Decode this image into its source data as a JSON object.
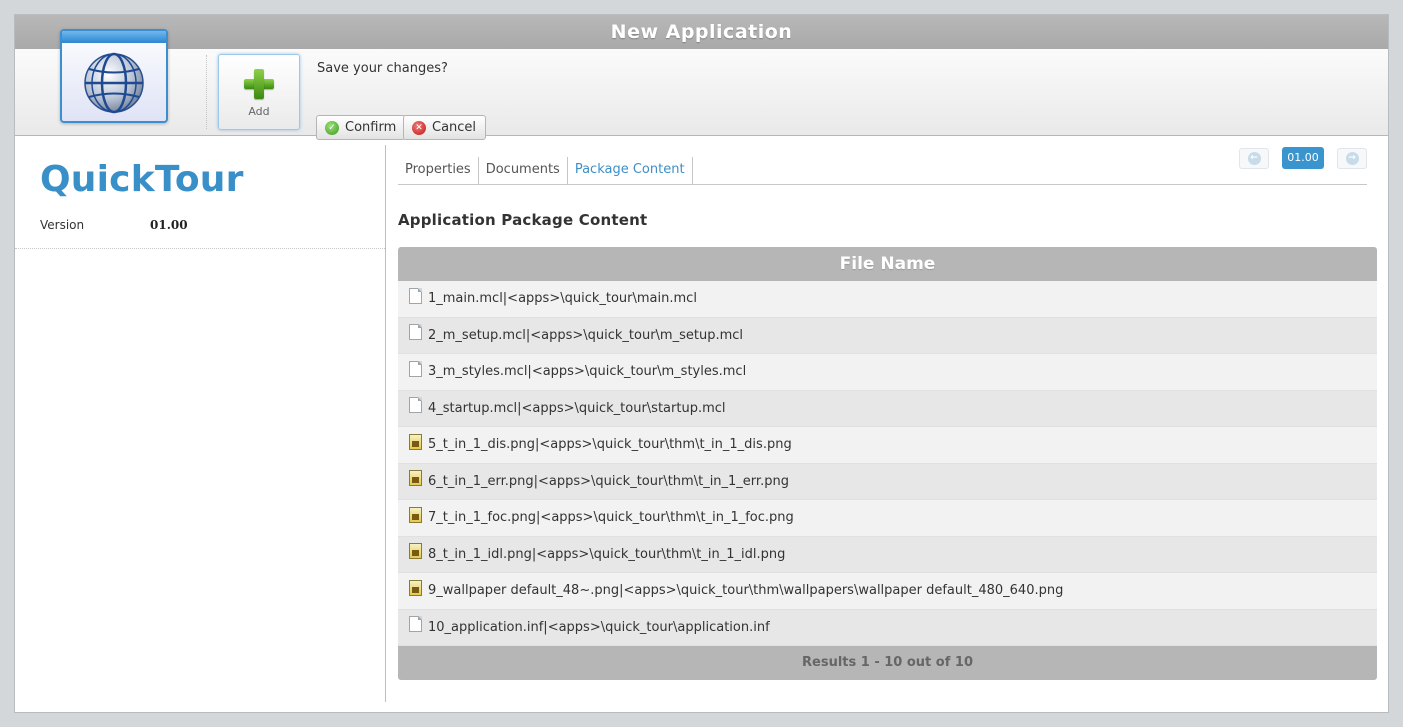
{
  "window": {
    "title": "New Application"
  },
  "toolbar": {
    "app_icon": "globe-window-icon",
    "add_label": "Add",
    "prompt": "Save your changes?",
    "confirm_label": "Confirm",
    "cancel_label": "Cancel",
    "confirm_icon": "check-circle-icon",
    "cancel_icon": "x-circle-icon"
  },
  "app": {
    "name": "QuickTour",
    "version_label": "Version",
    "version_value": "01.00"
  },
  "tabs": [
    {
      "label": "Properties",
      "active": false
    },
    {
      "label": "Documents",
      "active": false
    },
    {
      "label": "Package Content",
      "active": true
    }
  ],
  "pager": {
    "version": "01.00",
    "prev_icon": "arrow-left-circle-icon",
    "next_icon": "arrow-right-circle-icon"
  },
  "section_title": "Application Package Content",
  "grid": {
    "header": "File Name",
    "rows": [
      {
        "name": "1_main.mcl|<apps>\\quick_tour\\main.mcl",
        "icon": "doc"
      },
      {
        "name": "2_m_setup.mcl|<apps>\\quick_tour\\m_setup.mcl",
        "icon": "doc"
      },
      {
        "name": "3_m_styles.mcl|<apps>\\quick_tour\\m_styles.mcl",
        "icon": "doc"
      },
      {
        "name": "4_startup.mcl|<apps>\\quick_tour\\startup.mcl",
        "icon": "doc"
      },
      {
        "name": "5_t_in_1_dis.png|<apps>\\quick_tour\\thm\\t_in_1_dis.png",
        "icon": "img"
      },
      {
        "name": "6_t_in_1_err.png|<apps>\\quick_tour\\thm\\t_in_1_err.png",
        "icon": "img"
      },
      {
        "name": "7_t_in_1_foc.png|<apps>\\quick_tour\\thm\\t_in_1_foc.png",
        "icon": "img"
      },
      {
        "name": "8_t_in_1_idl.png|<apps>\\quick_tour\\thm\\t_in_1_idl.png",
        "icon": "img"
      },
      {
        "name": "9_wallpaper default_48~.png|<apps>\\quick_tour\\thm\\wallpapers\\wallpaper default_480_640.png",
        "icon": "img"
      },
      {
        "name": "10_application.inf|<apps>\\quick_tour\\application.inf",
        "icon": "doc"
      }
    ],
    "footer": "Results 1 - 10 out of 10"
  },
  "colors": {
    "accent": "#3a95cf",
    "title_bar": "#b6b6b6",
    "app_name": "#3990c8"
  }
}
